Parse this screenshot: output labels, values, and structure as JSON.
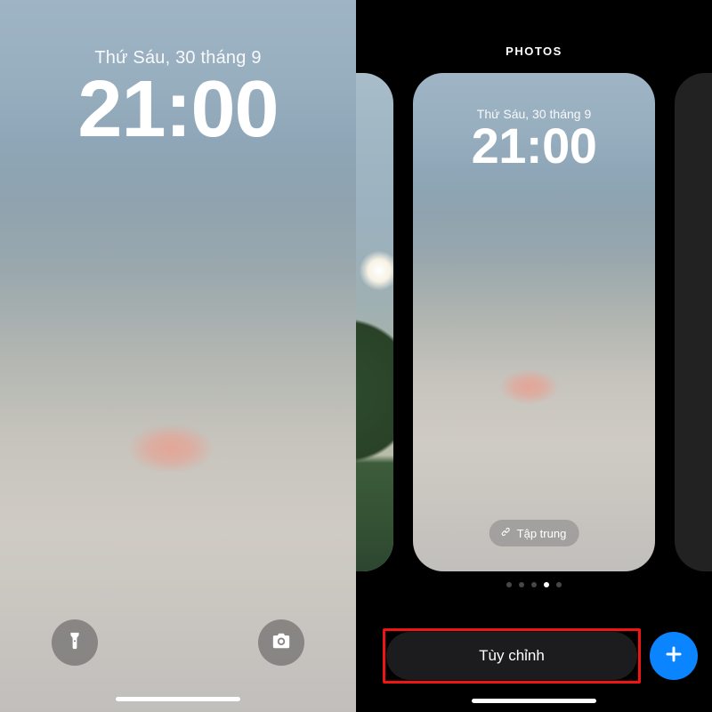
{
  "colors": {
    "accent": "#0a84ff",
    "highlight": "#f01515"
  },
  "lock": {
    "date": "Thứ Sáu, 30 tháng 9",
    "time": "21:00"
  },
  "gallery": {
    "title": "PHOTOS",
    "preview": {
      "date": "Thứ Sáu, 30 tháng 9",
      "time": "21:00"
    },
    "focus_label": "Tập trung",
    "page_dots": {
      "count": 5,
      "active_index": 3
    },
    "customize_label": "Tùy chỉnh"
  },
  "icons": {
    "flashlight": "flashlight-icon",
    "camera": "camera-icon",
    "link": "link-icon",
    "plus": "plus-icon"
  }
}
